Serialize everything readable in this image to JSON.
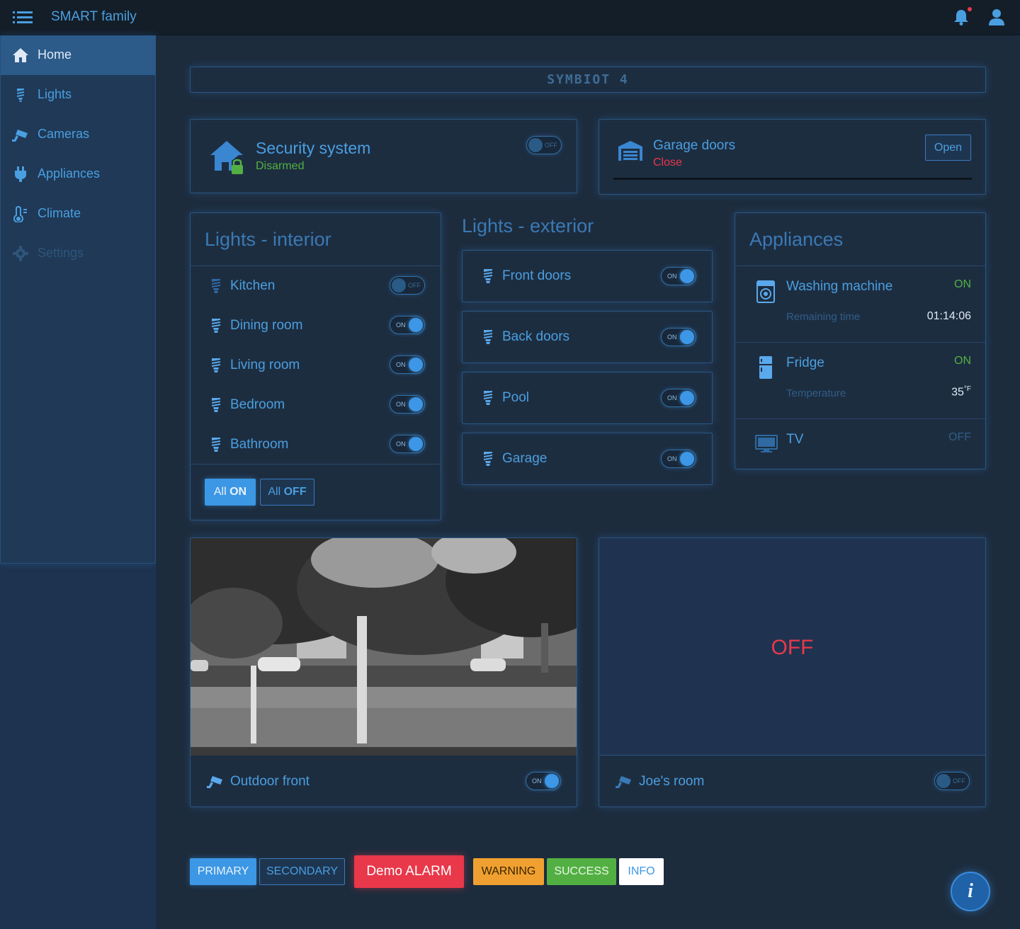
{
  "header": {
    "brand": "SMART family",
    "menu_icon": "menu-icon",
    "notification_icon": "bell-icon",
    "user_icon": "user-icon"
  },
  "sidebar": {
    "items": [
      {
        "label": "Home",
        "icon": "home-icon",
        "active": true
      },
      {
        "label": "Lights",
        "icon": "bulb-icon"
      },
      {
        "label": "Cameras",
        "icon": "camera-icon"
      },
      {
        "label": "Appliances",
        "icon": "plug-icon"
      },
      {
        "label": "Climate",
        "icon": "thermometer-icon"
      },
      {
        "label": "Settings",
        "icon": "gear-icon",
        "disabled": true
      }
    ]
  },
  "banner": {
    "logo": "SYMBIOT 4"
  },
  "security": {
    "title": "Security system",
    "status": "Disarmed",
    "toggle": "OFF"
  },
  "garage": {
    "title": "Garage doors",
    "status": "Close",
    "button": "Open"
  },
  "lights_interior": {
    "title": "Lights - interior",
    "rooms": [
      {
        "label": "Kitchen",
        "state": "OFF"
      },
      {
        "label": "Dining room",
        "state": "ON"
      },
      {
        "label": "Living room",
        "state": "ON"
      },
      {
        "label": "Bedroom",
        "state": "ON"
      },
      {
        "label": "Bathroom",
        "state": "ON"
      }
    ],
    "all_on_prefix": "All",
    "all_on_word": "ON",
    "all_off_prefix": "All",
    "all_off_word": "OFF"
  },
  "lights_exterior": {
    "title": "Lights - exterior",
    "items": [
      {
        "label": "Front doors",
        "state": "ON"
      },
      {
        "label": "Back doors",
        "state": "ON"
      },
      {
        "label": "Pool",
        "state": "ON"
      },
      {
        "label": "Garage",
        "state": "ON"
      }
    ]
  },
  "appliances": {
    "title": "Appliances",
    "washing": {
      "label": "Washing machine",
      "state": "ON",
      "detail_label": "Remaining time",
      "detail_value": "01:14:06"
    },
    "fridge": {
      "label": "Fridge",
      "state": "ON",
      "detail_label": "Temperature",
      "detail_value": "35",
      "detail_unit": "°F"
    },
    "tv": {
      "label": "TV",
      "state": "OFF"
    }
  },
  "cameras": {
    "outdoor": {
      "label": "Outdoor front",
      "state": "ON"
    },
    "joes": {
      "label": "Joe's room",
      "state": "OFF",
      "feed_text": "OFF"
    }
  },
  "bottom_buttons": {
    "primary": "PRIMARY",
    "secondary": "SECONDARY",
    "alarm": "Demo ALARM",
    "warning": "WARNING",
    "success": "SUCCESS",
    "info": "INFO"
  },
  "fab": {
    "label": "i"
  },
  "colors": {
    "accent": "#4a9fe0",
    "success": "#52b043",
    "danger": "#e8384a",
    "warning": "#f0a030"
  }
}
